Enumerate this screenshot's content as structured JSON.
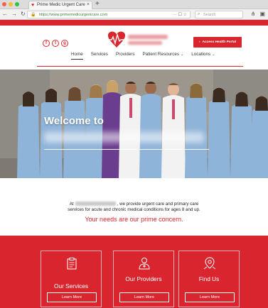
{
  "browser": {
    "tab_title": "Prime Medic Urgent Care",
    "tab_close": "×",
    "new_tab": "+",
    "url": "https://www.primemedicurgentcare.com",
    "url_icons": "··· ☐ ☆",
    "search_placeholder": "Search",
    "back": "←",
    "forward": "→",
    "reload": "↻",
    "home": "⌂",
    "right_controls": [
      "⋔",
      "▣"
    ]
  },
  "header": {
    "socials": [
      "f",
      "t",
      "g"
    ],
    "logo_text_line1": "Prime Medic",
    "logo_text_line2": "Urgent Care",
    "portal_button": "Access Health Portal",
    "portal_chevron": "›",
    "menu": [
      {
        "label": "Home",
        "caret": ""
      },
      {
        "label": "Services",
        "caret": ""
      },
      {
        "label": "Providers",
        "caret": ""
      },
      {
        "label": "Patient Resources",
        "caret": "⌄"
      },
      {
        "label": "Locations",
        "caret": "⌄"
      }
    ]
  },
  "hero": {
    "welcome": "Welcome to"
  },
  "intro": {
    "line1_prefix": "At",
    "line1_suffix": ", we provide urgent care and primary care",
    "line2": "services for acute and chronic medical conditions for ages 8 and up.",
    "tagline": "Your needs are our prime concern."
  },
  "cards": [
    {
      "title": "Our Services",
      "button": "Learn More",
      "icon": "clipboard-icon"
    },
    {
      "title": "Our Providers",
      "button": "Learn More",
      "icon": "doctor-icon"
    },
    {
      "title": "Find Us",
      "button": "Learn More",
      "icon": "map-pin-icon"
    }
  ],
  "colors": {
    "brand_red": "#d9262e",
    "scrub_blue": "#8fb4d9",
    "scrub_purple": "#6b3d8f"
  }
}
